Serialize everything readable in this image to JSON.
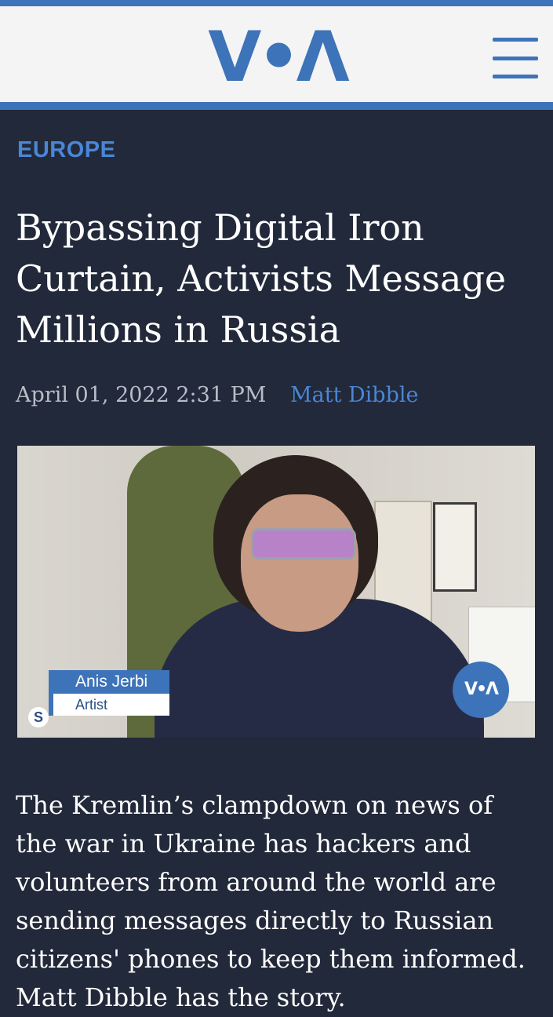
{
  "header": {
    "logo_text": "V•Λ",
    "menu_icon": "hamburger-menu-icon",
    "brand_color": "#3d73b8"
  },
  "article": {
    "category": "EUROPE",
    "headline": "Bypassing Digital Iron Curtain, Activists Message Millions in Russia",
    "date": "April 01, 2022 2:31 PM",
    "author": "Matt Dibble",
    "video": {
      "lower_third_name": "Anis Jerbi",
      "lower_third_role": "Artist",
      "skype_glyph": "S",
      "voa_bug_text": "V•Λ"
    },
    "body": "The Kremlin’s clampdown on news of the war in Ukraine has hackers and volunteers from around the world are sending messages directly to Russian citizens' phones to keep them informed. Matt Dibble has the story."
  },
  "colors": {
    "background": "#22293a",
    "accent": "#4a86d6",
    "meta_text": "#b7bcc6"
  }
}
